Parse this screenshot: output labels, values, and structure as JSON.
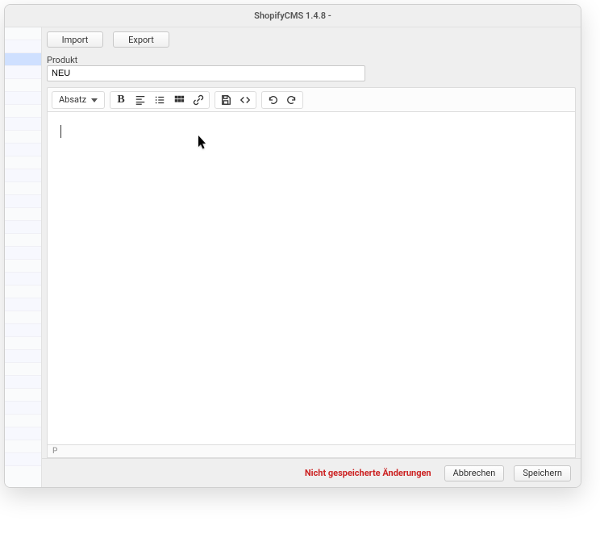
{
  "window": {
    "title": "ShopifyCMS 1.4.8 -"
  },
  "toolbar": {
    "import_label": "Import",
    "export_label": "Export"
  },
  "product": {
    "label": "Produkt",
    "value": "NEU"
  },
  "editor": {
    "format_label": "Absatz",
    "status_path": "P"
  },
  "icons": {
    "bold": "bold-icon",
    "align": "align-icon",
    "list": "list-icon",
    "grid": "grid-icon",
    "link": "link-icon",
    "save": "save-icon",
    "code": "code-icon",
    "undo": "undo-icon",
    "redo": "redo-icon"
  },
  "footer": {
    "unsaved_message": "Nicht gespeicherte Änderungen",
    "cancel_label": "Abbrechen",
    "save_label": "Speichern"
  }
}
